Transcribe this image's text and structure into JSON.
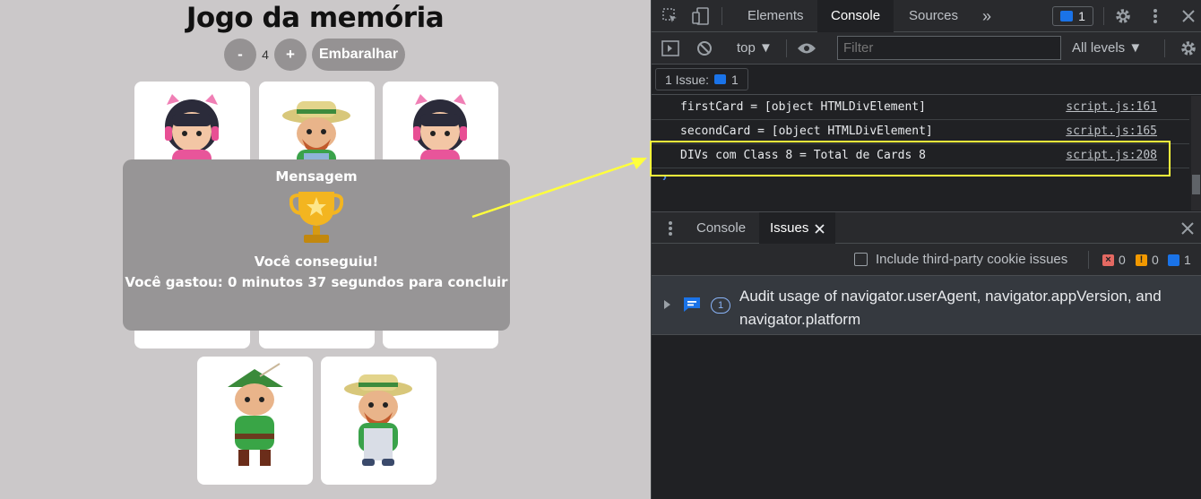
{
  "game": {
    "title": "Jogo da memória",
    "minus_label": "-",
    "plus_label": "+",
    "count": "4",
    "shuffle_label": "Embaralhar",
    "cards": [
      "girl-headset-card",
      "farmer-card",
      "girl-headset-card",
      "hidden-card",
      "hidden-card",
      "hidden-card",
      "archer-card",
      "farmer-card"
    ]
  },
  "modal": {
    "title": "Mensagem",
    "line1": "Você conseguiu!",
    "line2": "Você gastou: 0 minutos 37 segundos para concluir"
  },
  "devtools": {
    "tabs": [
      "Elements",
      "Console",
      "Sources"
    ],
    "active_tab": "Console",
    "more_tabs": "»",
    "issues_badge_count": "1",
    "context": "top",
    "filter_placeholder": "Filter",
    "levels": "All levels",
    "issue_chip": {
      "label": "1 Issue:",
      "count": "1"
    },
    "console_lines": [
      {
        "message": "firstCard = [object HTMLDivElement]",
        "source": "script.js:161"
      },
      {
        "message": "secondCard = [object HTMLDivElement]",
        "source": "script.js:165"
      },
      {
        "message": "DIVs com Class 8 = Total de Cards 8",
        "source": "script.js:208"
      }
    ],
    "prompt": "›",
    "drawer_tabs": [
      "Console",
      "Issues"
    ],
    "drawer_active": "Issues",
    "third_party_label": "Include third-party cookie issues",
    "counts": {
      "errors": "0",
      "warnings": "0",
      "info": "1"
    },
    "issue": {
      "text": "Audit usage of navigator.userAgent, navigator.appVersion, and navigator.platform",
      "count": "1"
    }
  },
  "colors": {
    "highlight": "#ffff3c",
    "accent": "#1a73e8",
    "error": "#e46962",
    "warning": "#f29900"
  }
}
